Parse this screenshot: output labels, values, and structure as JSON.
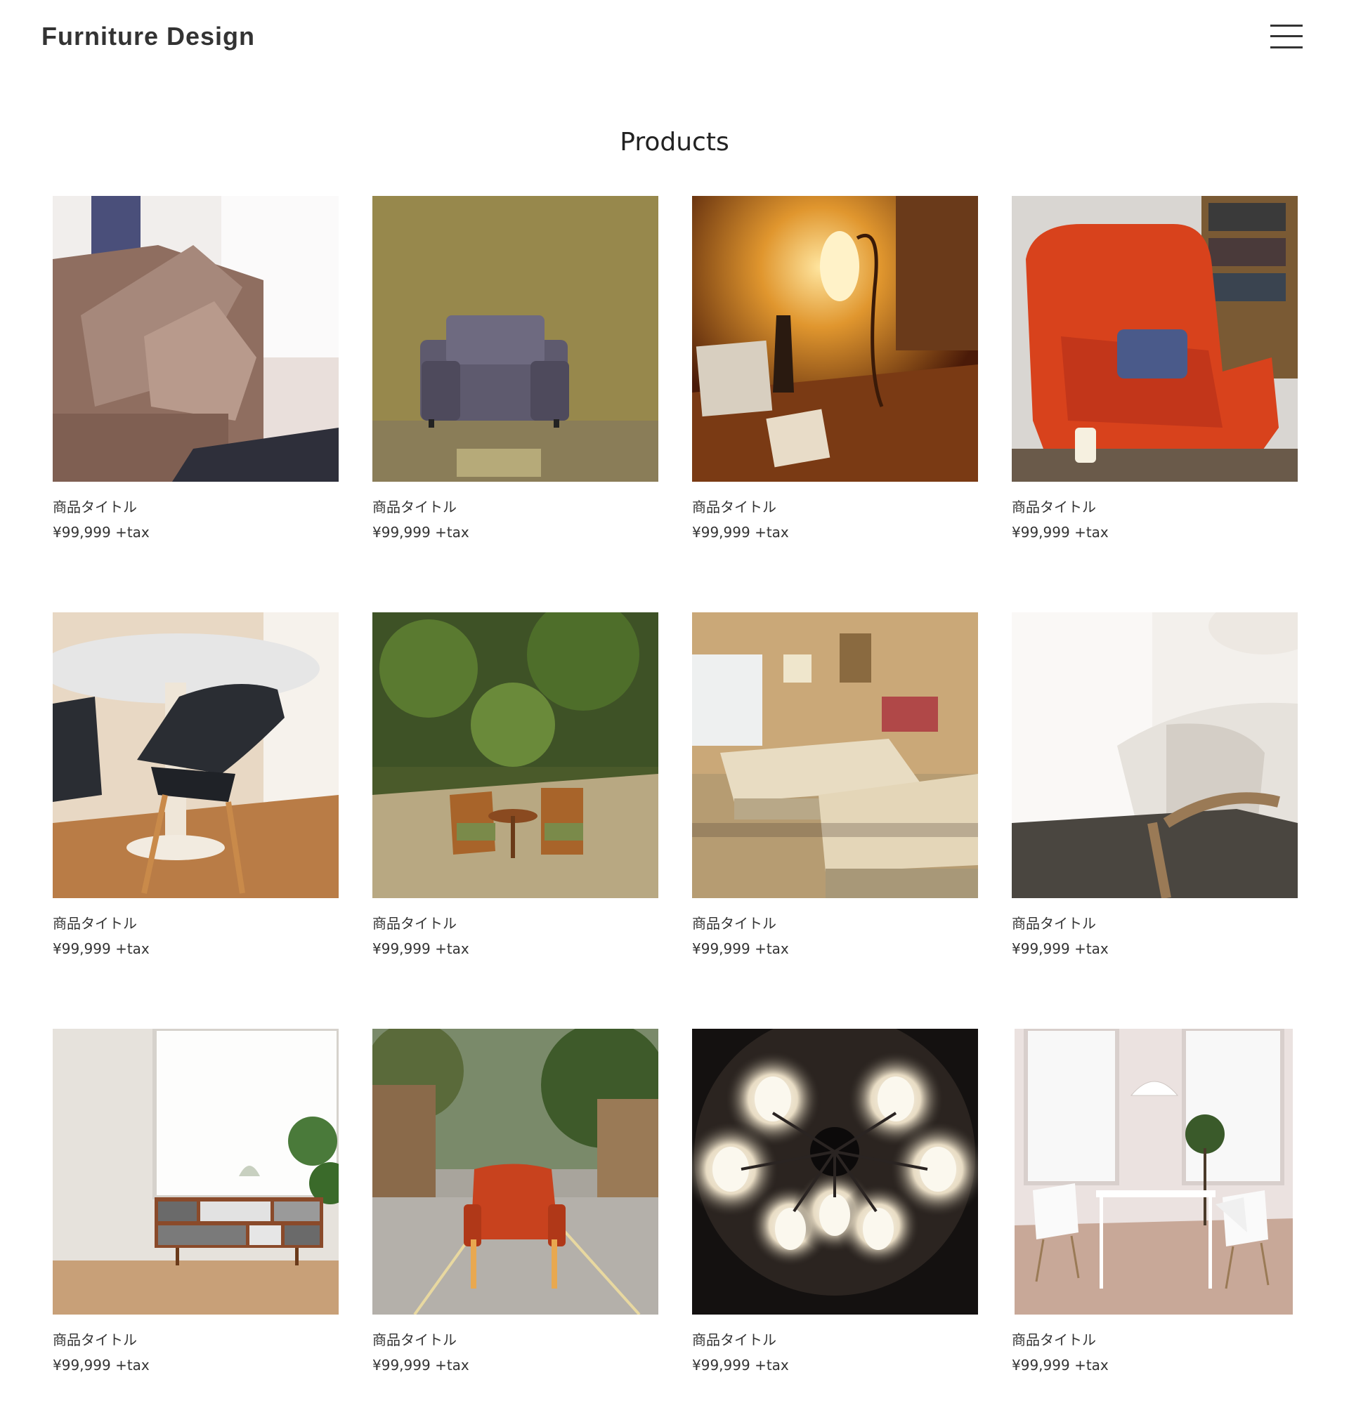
{
  "header": {
    "site_title": "Furniture Design",
    "menu_icon": "hamburger-menu-icon"
  },
  "products_section": {
    "title": "Products",
    "items": [
      {
        "title": "商品タイトル",
        "price": "¥99,999 +tax",
        "image": "sofa-with-cushions-photo"
      },
      {
        "title": "商品タイトル",
        "price": "¥99,999 +tax",
        "image": "armchair-against-wallpaper-photo"
      },
      {
        "title": "商品タイトル",
        "price": "¥99,999 +tax",
        "image": "table-lamp-photo"
      },
      {
        "title": "商品タイトル",
        "price": "¥99,999 +tax",
        "image": "red-wingback-chair-photo"
      },
      {
        "title": "商品タイトル",
        "price": "¥99,999 +tax",
        "image": "round-table-and-chairs-photo"
      },
      {
        "title": "商品タイトル",
        "price": "¥99,999 +tax",
        "image": "garden-patio-chairs-photo"
      },
      {
        "title": "商品タイトル",
        "price": "¥99,999 +tax",
        "image": "hotel-twin-beds-photo"
      },
      {
        "title": "商品タイトル",
        "price": "¥99,999 +tax",
        "image": "chair-with-pillow-photo"
      },
      {
        "title": "商品タイトル",
        "price": "¥99,999 +tax",
        "image": "sideboard-cabinet-photo"
      },
      {
        "title": "商品タイトル",
        "price": "¥99,999 +tax",
        "image": "red-armchair-on-street-photo"
      },
      {
        "title": "商品タイトル",
        "price": "¥99,999 +tax",
        "image": "ceiling-chandelier-photo"
      },
      {
        "title": "商品タイトル",
        "price": "¥99,999 +tax",
        "image": "white-dining-set-photo"
      }
    ]
  }
}
